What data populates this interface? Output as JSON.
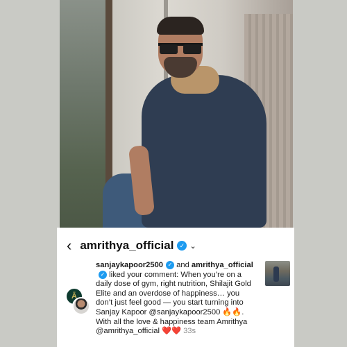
{
  "header": {
    "back_glyph": "‹",
    "username": "amrithya_official",
    "verified_glyph": "✓",
    "dropdown_glyph": "⌄"
  },
  "notification": {
    "actor1": "sanjaykapoor2500",
    "and_text": " and",
    "actor2": "amrithya_official",
    "action_text": " liked your comment: When you’re on a daily dose of gym, right nutrition, Shilajit Gold Elite and an overdose of happiness… you don’t just feel good — you start turning into Sanjay Kapoor @sanjaykapoor2500 ",
    "fire_emoji": "🔥🔥",
    "closing_text": ". With all the love & happiness team Amrithya @amrithya_official ",
    "heart_emoji": "❤️❤️",
    "timestamp": "33s"
  },
  "avatars": {
    "brand_initial": "Ā"
  },
  "colors": {
    "background": "#c9cac5",
    "card": "#ffffff",
    "verified_blue": "#1d9bf0",
    "timestamp_gray": "#8e8e8e"
  }
}
